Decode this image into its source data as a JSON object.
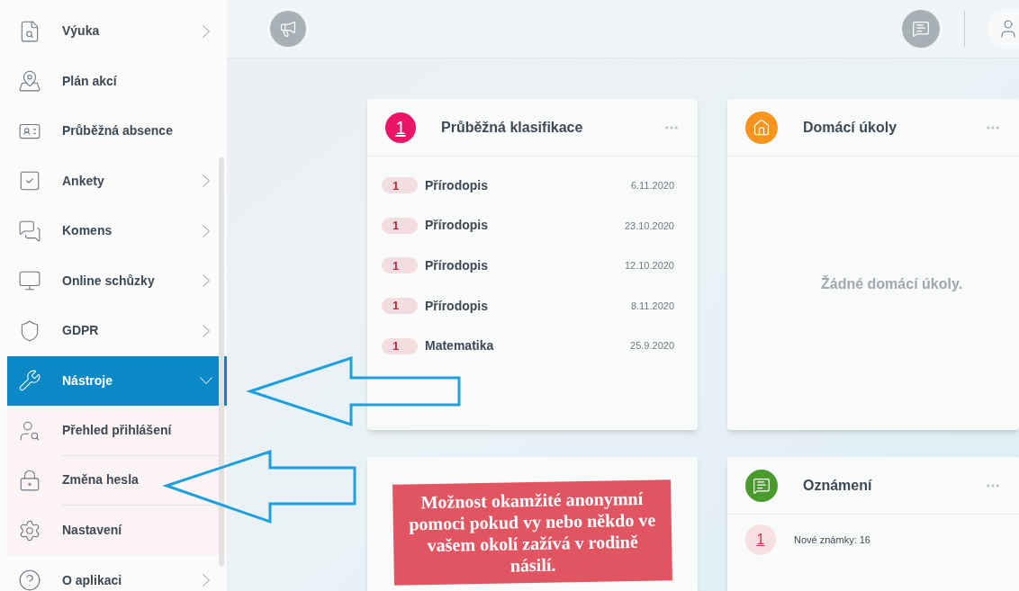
{
  "sidebar": {
    "items": [
      {
        "label": "Výuka",
        "expandable": true,
        "expanded": false,
        "selected": false
      },
      {
        "label": "Plán akcí",
        "expandable": false,
        "selected": false
      },
      {
        "label": "Průběžná absence",
        "expandable": false,
        "selected": false
      },
      {
        "label": "Ankety",
        "expandable": true,
        "expanded": false,
        "selected": false
      },
      {
        "label": "Komens",
        "expandable": true,
        "expanded": false,
        "selected": false
      },
      {
        "label": "Online schůzky",
        "expandable": true,
        "expanded": false,
        "selected": false
      },
      {
        "label": "GDPR",
        "expandable": true,
        "expanded": false,
        "selected": false
      },
      {
        "label": "Nástroje",
        "expandable": true,
        "expanded": true,
        "selected": true,
        "children": [
          {
            "label": "Přehled přihlášení"
          },
          {
            "label": "Změna hesla"
          },
          {
            "label": "Nastavení"
          }
        ]
      },
      {
        "label": "O aplikaci",
        "expandable": true,
        "expanded": false,
        "selected": false
      }
    ]
  },
  "grades_card": {
    "title": "Průběžná klasifikace",
    "badge": "1",
    "rows": [
      {
        "grade": "1",
        "subject": "Přírodopis",
        "date": "6.11.2020"
      },
      {
        "grade": "1",
        "subject": "Přírodopis",
        "date": "23.10.2020"
      },
      {
        "grade": "1",
        "subject": "Přírodopis",
        "date": "12.10.2020"
      },
      {
        "grade": "1",
        "subject": "Přírodopis",
        "date": "8.11.2020"
      },
      {
        "grade": "1",
        "subject": "Matematika",
        "date": "25.9.2020"
      }
    ]
  },
  "homework_card": {
    "title": "Domácí úkoly",
    "empty_text": "Žádné domácí úkoly."
  },
  "banner": {
    "text": "Možnost okamžité anonymní pomoci pokud vy nebo někdo ve vašem okolí zažívá v rodině násilí."
  },
  "announcements_card": {
    "title": "Oznámení",
    "items": [
      {
        "badge": "1",
        "text": "Nové známky: 16"
      }
    ]
  }
}
